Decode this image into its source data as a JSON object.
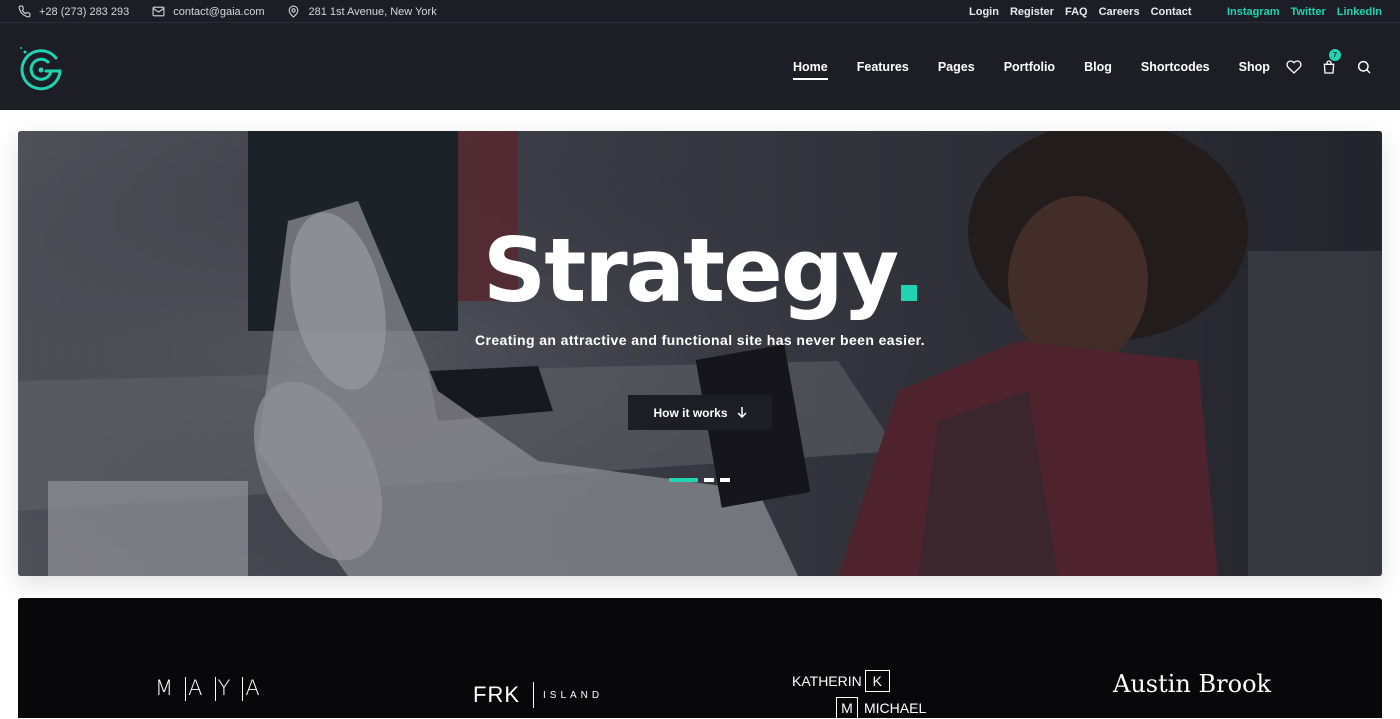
{
  "topbar": {
    "phone": "+28 (273) 283 293",
    "email": "contact@gaia.com",
    "address": "281 1st Avenue, New York",
    "links": [
      "Login",
      "Register",
      "FAQ",
      "Careers",
      "Contact"
    ],
    "social": [
      "Instagram",
      "Twitter",
      "LinkedIn"
    ]
  },
  "nav": {
    "items": [
      "Home",
      "Features",
      "Pages",
      "Portfolio",
      "Blog",
      "Shortcodes",
      "Shop"
    ],
    "active": "Home",
    "cart_count": "7"
  },
  "hero": {
    "title": "Strategy",
    "subtitle": "Creating an attractive and functional site has never been easier.",
    "button_label": "How it works",
    "slides": 3,
    "active_slide": 1
  },
  "brands": {
    "maya": [
      "M",
      "A",
      "Y",
      "A"
    ],
    "frk_main": "FRK",
    "frk_sub": "ISLAND",
    "kath_first": "KATHERIN",
    "kath_k": "K",
    "kath_m": "M",
    "kath_last": "MICHAEL",
    "austin": "Austin Brook"
  },
  "colors": {
    "accent": "#21d4b1",
    "header_bg": "#1d1d26",
    "logos_bg": "#08080a"
  }
}
